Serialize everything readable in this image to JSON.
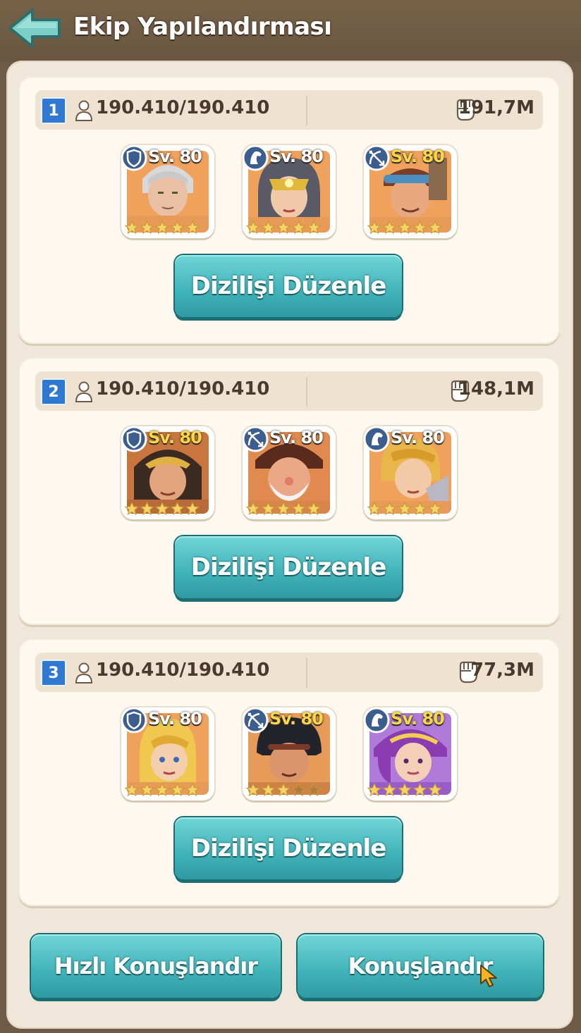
{
  "header": {
    "title": "Ekip Yapılandırması"
  },
  "level_prefix": "Sv.",
  "teams": [
    {
      "number": "1",
      "capacity": "190.410/190.410",
      "power": "191,7M",
      "edit_label": "Dizilişi Düzenle",
      "heroes": [
        {
          "class_icon": "shield-icon",
          "level": "80",
          "stars": 5,
          "level_color": "white"
        },
        {
          "class_icon": "horse-icon",
          "level": "80",
          "stars": 5,
          "level_color": "white"
        },
        {
          "class_icon": "crossbow-icon",
          "level": "80",
          "stars": 5,
          "level_color": "gold"
        }
      ]
    },
    {
      "number": "2",
      "capacity": "190.410/190.410",
      "power": "148,1M",
      "edit_label": "Dizilişi Düzenle",
      "heroes": [
        {
          "class_icon": "shield-icon",
          "level": "80",
          "stars": 5,
          "level_color": "gold"
        },
        {
          "class_icon": "crossbow-icon",
          "level": "80",
          "stars": 5,
          "level_color": "white"
        },
        {
          "class_icon": "horse-icon",
          "level": "80",
          "stars": 5,
          "level_color": "white"
        }
      ]
    },
    {
      "number": "3",
      "capacity": "190.410/190.410",
      "power": "77,3M",
      "edit_label": "Dizilişi Düzenle",
      "heroes": [
        {
          "class_icon": "shield-icon",
          "level": "80",
          "stars": 5,
          "level_color": "white"
        },
        {
          "class_icon": "crossbow-icon",
          "level": "80",
          "stars": 3,
          "level_color": "gold"
        },
        {
          "class_icon": "horse-icon",
          "level": "80",
          "stars": 5,
          "level_color": "gold"
        }
      ]
    }
  ],
  "footer": {
    "quick_deploy_label": "Hızlı Konuşlandır",
    "deploy_label": "Konuşlandır"
  },
  "colors": {
    "accent_teal": "#3fb3b8",
    "badge_blue": "#2f7ad0",
    "gold_level": "#f7d64a",
    "epic_purple": "#9a5cc9"
  }
}
